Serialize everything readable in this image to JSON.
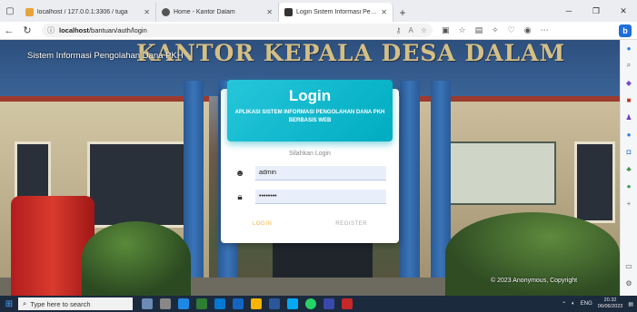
{
  "browser": {
    "tabs": [
      {
        "title": "localhost / 127.0.0.1:3306 / tuga",
        "color": "#e8a33c",
        "active": false
      },
      {
        "title": "Home - Kantor Dalam",
        "color": "#555555",
        "active": false
      },
      {
        "title": "Login Sistem Informasi Pengolah",
        "color": "#333333",
        "active": true
      }
    ],
    "url_host": "localhost",
    "url_path": "/bantuan/auth/login"
  },
  "page": {
    "banner": "KANTOR KEPALA DESA DALAM",
    "app_name": "Sistem Informasi Pengolahan Dana PKH",
    "copyright": "© 2023 Anonymous, Copyright"
  },
  "login": {
    "title": "Login",
    "subtitle": "APLIKASI SISTEM INFORMASI PENGOLAHAN DANA PKH BERBASIS WEB",
    "prompt": "Silahkan Login",
    "username_value": "admin",
    "password_value": "••••••••",
    "login_label": "LOGIN",
    "register_label": "REGISTER",
    "accent_color": "#00acc1"
  },
  "taskbar": {
    "search_placeholder": "Type here to search",
    "lang": "ENG",
    "time": "20.32",
    "date": "06/06/2023"
  }
}
